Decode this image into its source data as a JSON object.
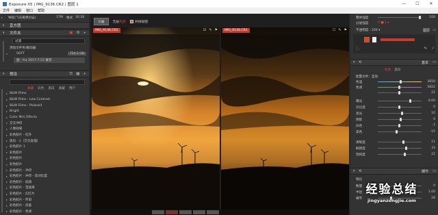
{
  "window": {
    "title": "Exposure X5 | IMG_9136.CR2 | 图层 1",
    "min": "—",
    "max": "☐",
    "close": "✕"
  },
  "menu": [
    "文件",
    "编辑",
    "窗口",
    "帮助"
  ],
  "left": {
    "top_row": {
      "label": "导航(飞天黄佛论坛)",
      "size": "17M",
      "tag": "格式",
      "time": "16:26"
    },
    "histogram": "直方图",
    "folders": {
      "title": "文件夹",
      "search_placeholder": "过滤",
      "add_text": "添加文件夹/磁动器",
      "source_label": "SOFT",
      "source_size": "754.2 GB",
      "selected_folder": "图 · 9 ▸ 2017-7-22 蒙宏"
    },
    "presets": {
      "title": "预设",
      "tabs": [
        "收藏",
        "彩色",
        "黑白",
        "收藏",
        "用户"
      ],
      "active_tab": 0,
      "items": [
        "B&W Films",
        "B&W Films - Low Contrast",
        "B&W Films - Polaroid",
        "Bright",
        "Color Mini Effects",
        "交叉冲印",
        "人像效果",
        "彩色胶片 - 红外",
        "黑白 - 1（交叉处理）",
        "彩色胶片 1",
        "彩色胶片",
        "彩色胶片",
        "彩色胶片",
        "彩色胶片 - 冲印",
        "彩色胶片 - 冲印 - 高对比度",
        "彩色胶片 - 低调",
        "彩色胶片 - 宝丽来",
        "彩色胶片 - 幻灯片",
        "彩色胶片 - 怀旧",
        "彩色胶片 - 反差",
        "彩色胶片 - 色调"
      ]
    }
  },
  "toolbar": {
    "mode": "三层",
    "layer": "无层",
    "tag": "先前",
    "checkbox": "并排视图"
  },
  "panes": [
    {
      "label": "IMG_9136.CR2"
    },
    {
      "label": "IMG_9136.CR2"
    }
  ],
  "right": {
    "top": {
      "rows": [
        {
          "label": "整体强度",
          "value": "100"
        },
        {
          "label": "分层强度",
          "value": "0 ■ 1 ▸"
        }
      ],
      "opacity": "不透明度 : 100 ▾"
    },
    "layers": {
      "title": "图层"
    },
    "basic": {
      "title": "基本",
      "seg": [
        "彩色",
        "黑白"
      ],
      "rows": [
        {
          "label": "色温",
          "value": "3650"
        },
        {
          "label": "色调",
          "value": "5822"
        },
        {
          "label": "",
          "value": "22"
        },
        {
          "label": "曝光",
          "value": "0.00"
        },
        {
          "label": "对比度",
          "value": "0"
        },
        {
          "label": "高光",
          "value": "10"
        },
        {
          "label": "阴影",
          "value": "6"
        },
        {
          "label": "白色",
          "value": "-7"
        },
        {
          "label": "黑色",
          "value": "-15"
        },
        {
          "label": "清晰度",
          "value": "11"
        },
        {
          "label": "鲜艳度",
          "value": "33"
        },
        {
          "label": "饱和度",
          "value": "22"
        }
      ],
      "wb_label": "配置文件：自动"
    },
    "detail": {
      "title": "细节",
      "sub": "锐化",
      "rows": [
        {
          "label": "数量",
          "value": "0"
        },
        {
          "label": "半径",
          "value": "1.00"
        },
        {
          "label": "细节",
          "value": "28"
        }
      ]
    }
  },
  "watermark": {
    "title": "经验总结",
    "url": "jingyanzongjie.com"
  }
}
